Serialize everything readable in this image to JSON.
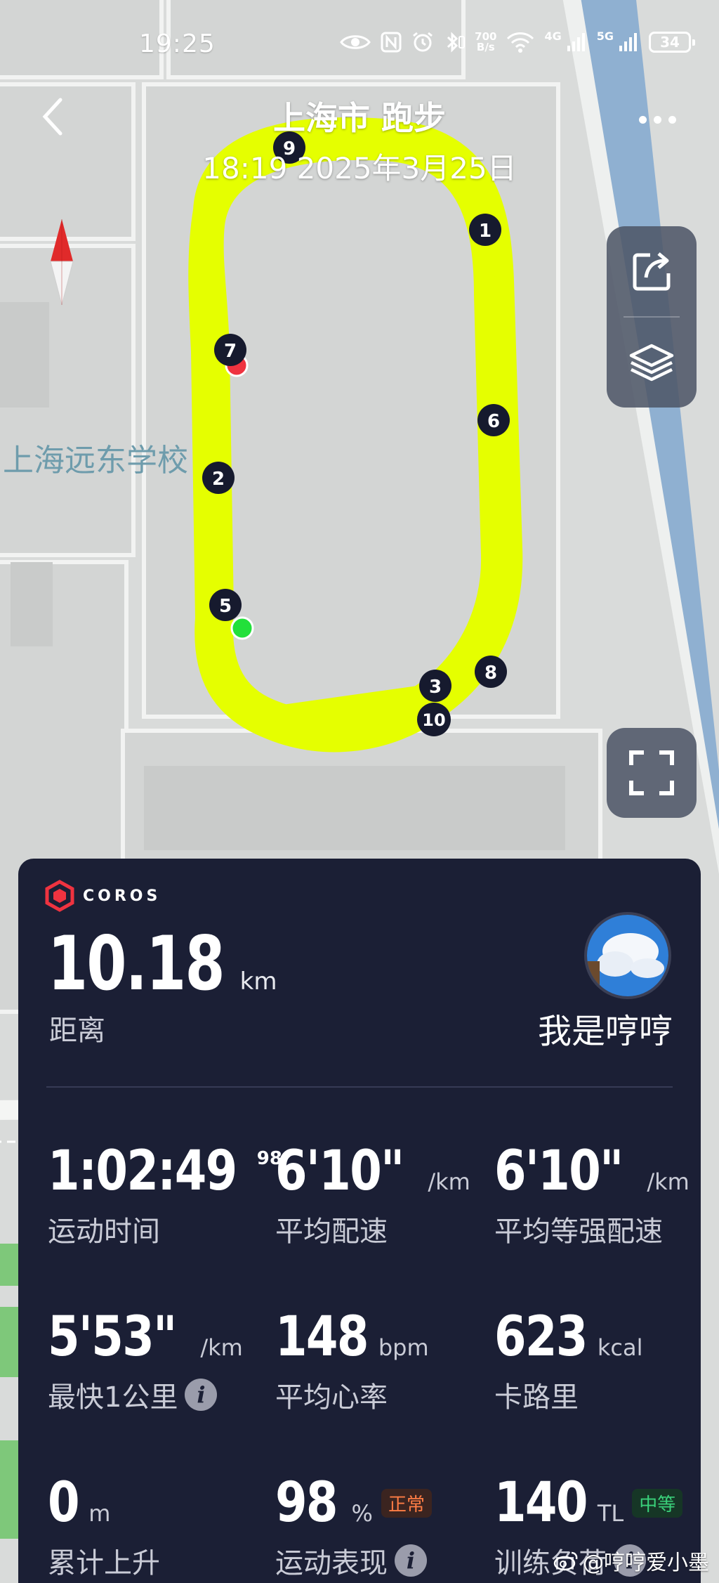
{
  "status_bar": {
    "time": "19:25",
    "net_speed_value": "700",
    "net_speed_unit": "B/s",
    "signal_1_label": "4G",
    "signal_2_label": "5G",
    "battery": "34",
    "icons": [
      "eye-icon",
      "nfc-icon",
      "alarm-icon",
      "bluetooth-icon",
      "wifi-icon",
      "signal-icon",
      "battery-icon"
    ]
  },
  "header": {
    "title": "上海市 跑步",
    "subtitle": "18:19 2025年3月25日"
  },
  "map": {
    "place_label": "上海远东学校",
    "route_color": "#e5ff00",
    "start_marker_color": "#22e03a",
    "end_marker_color": "#ef3340",
    "lap_markers": [
      "1",
      "2",
      "3",
      "5",
      "6",
      "7",
      "8",
      "9",
      "10"
    ]
  },
  "card": {
    "brand": "COROS",
    "distance_value": "10.18",
    "distance_unit": "km",
    "distance_label": "距离",
    "username": "我是哼哼",
    "stats": [
      {
        "value": "1:02:49",
        "sup": "98",
        "unit": "",
        "label": "运动时间"
      },
      {
        "value": "6'10\"",
        "unit": "/km",
        "label": "平均配速"
      },
      {
        "value": "6'10\"",
        "unit": "/km",
        "label": "平均等强配速"
      },
      {
        "value": "5'53\"",
        "unit": "/km",
        "label": "最快1公里"
      },
      {
        "value": "148",
        "unit": "bpm",
        "label": "平均心率"
      },
      {
        "value": "623",
        "unit": "kcal",
        "label": "卡路里"
      },
      {
        "value": "0",
        "unit": "m",
        "label": "累计上升"
      },
      {
        "value": "98",
        "unit": "%",
        "badge": "正常",
        "label": "运动表现"
      },
      {
        "value": "140",
        "unit": "TL",
        "badge": "中等",
        "label": "训练负荷"
      }
    ],
    "info_icon_char": "i"
  },
  "watermark": "@哼哼爱小墨"
}
